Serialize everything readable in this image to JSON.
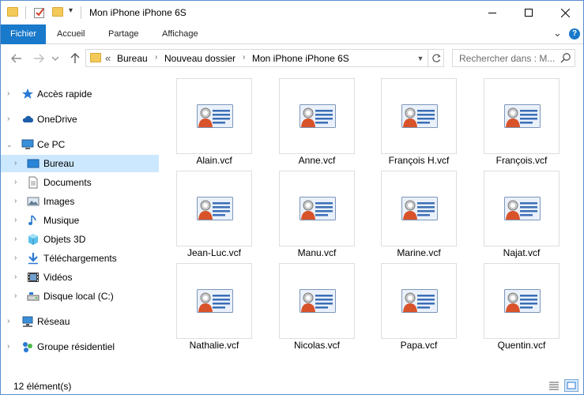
{
  "window": {
    "title": "Mon iPhone iPhone 6S"
  },
  "controls": {
    "minimize": "–",
    "maximize": "☐",
    "close": "✕"
  },
  "ribbon": {
    "tabs": [
      {
        "label": "Fichier"
      },
      {
        "label": "Accueil"
      },
      {
        "label": "Partage"
      },
      {
        "label": "Affichage"
      }
    ],
    "expand": "⌄",
    "help": "?"
  },
  "address": {
    "overflow": "«",
    "crumbs": [
      "Bureau",
      "Nouveau dossier",
      "Mon iPhone iPhone 6S"
    ]
  },
  "search": {
    "placeholder": "Rechercher dans : M..."
  },
  "nav": {
    "items": [
      {
        "label": "Accès rapide"
      },
      {
        "label": "OneDrive"
      },
      {
        "label": "Ce PC"
      },
      {
        "label": "Bureau"
      },
      {
        "label": "Documents"
      },
      {
        "label": "Images"
      },
      {
        "label": "Musique"
      },
      {
        "label": "Objets 3D"
      },
      {
        "label": "Téléchargements"
      },
      {
        "label": "Vidéos"
      },
      {
        "label": "Disque local (C:)"
      },
      {
        "label": "Réseau"
      },
      {
        "label": "Groupe résidentiel"
      }
    ]
  },
  "files": [
    {
      "name": "Alain.vcf"
    },
    {
      "name": "Anne.vcf"
    },
    {
      "name": "François H.vcf"
    },
    {
      "name": "François.vcf"
    },
    {
      "name": "Jean-Luc.vcf"
    },
    {
      "name": "Manu.vcf"
    },
    {
      "name": "Marine.vcf"
    },
    {
      "name": "Najat.vcf"
    },
    {
      "name": "Nathalie.vcf"
    },
    {
      "name": "Nicolas.vcf"
    },
    {
      "name": "Papa.vcf"
    },
    {
      "name": "Quentin.vcf"
    }
  ],
  "status": {
    "count": "12 élément(s)"
  },
  "colors": {
    "accent": "#1979ca",
    "selection": "#cce8ff",
    "folder": "#f3c95a"
  }
}
